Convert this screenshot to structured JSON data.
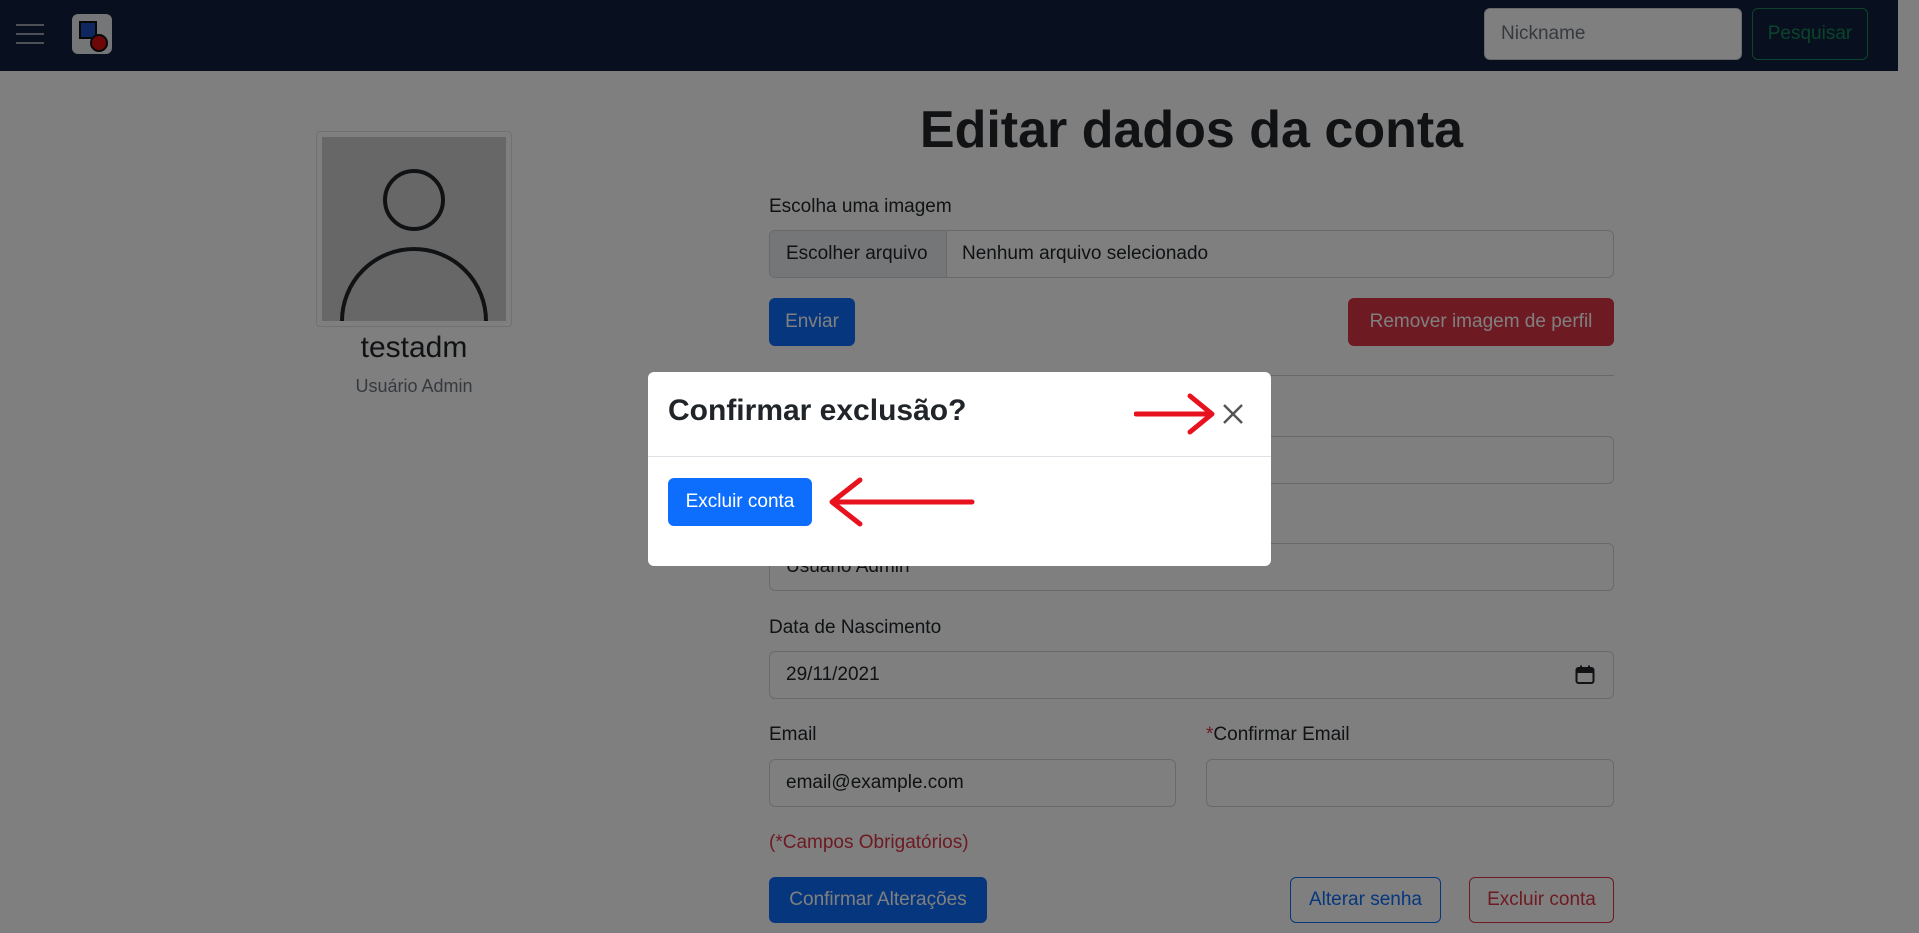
{
  "navbar": {
    "menu_icon": "hamburger-menu-icon",
    "logo_icon": "app-logo-icon",
    "search_placeholder": "Nickname",
    "search_button": "Pesquisar"
  },
  "profile": {
    "avatar_icon": "user-avatar-icon",
    "username": "testadm",
    "user_type": "Usuário Admin"
  },
  "form": {
    "title": "Editar dados da conta",
    "image_label": "Escolha uma imagem",
    "file_button": "Escolher arquivo",
    "file_status": "Nenhum arquivo selecionado",
    "send_button": "Enviar",
    "remove_image_button": "Remover imagem de perfil",
    "user_type_value": "Usuário Admin",
    "birth_label": "Data de Nascimento",
    "birth_value": "29/11/2021",
    "email_label": "Email",
    "email_value": "email@example.com",
    "confirm_email_required": "*",
    "confirm_email_label": "Confirmar Email",
    "confirm_email_value": "",
    "required_note": "(*Campos Obrigatórios)",
    "confirm_button": "Confirmar Alterações",
    "change_password_button": "Alterar senha",
    "delete_account_button": "Excluir conta"
  },
  "modal": {
    "title": "Confirmar exclusão?",
    "close_icon": "close-x-icon",
    "delete_button": "Excluir conta"
  },
  "colors": {
    "navbar": "#10203f",
    "primary": "#0d6efd",
    "danger": "#dc3545",
    "success": "#198754",
    "annotation_arrow": "#e8121f"
  }
}
